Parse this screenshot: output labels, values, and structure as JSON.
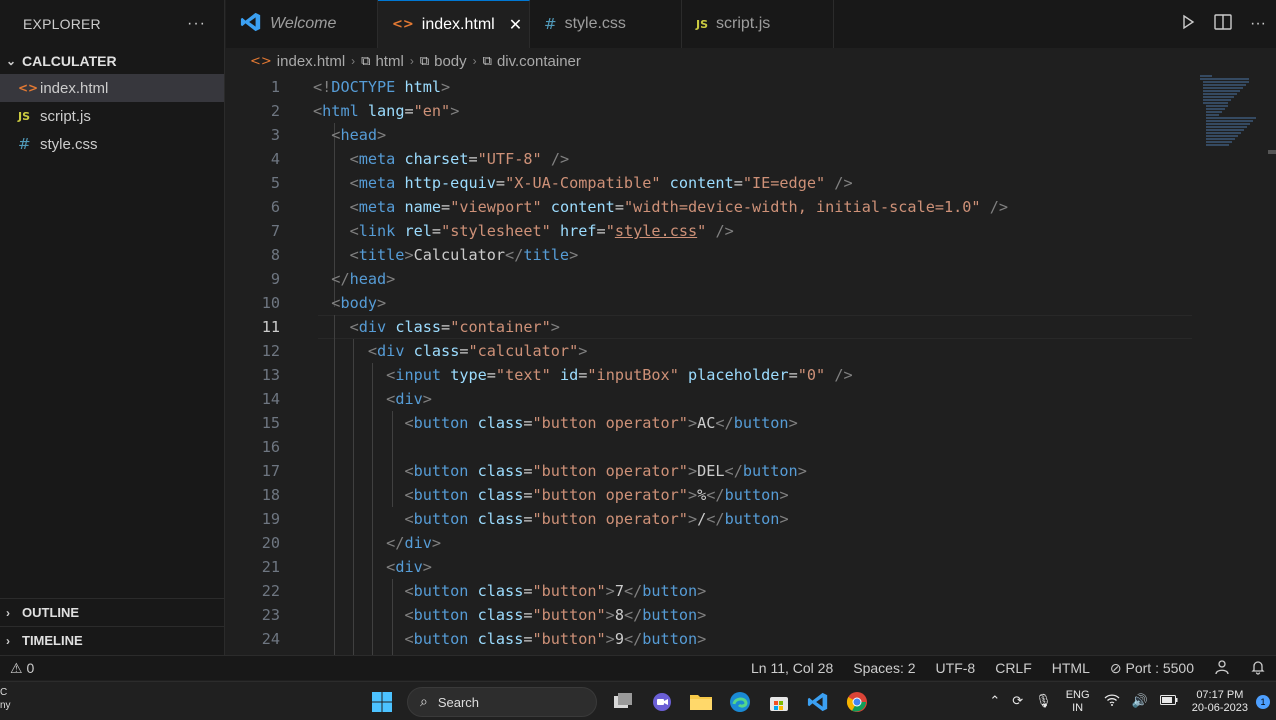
{
  "sidebar": {
    "header": "EXPLORER",
    "more": "···",
    "folder": "CALCULATER",
    "files": [
      {
        "label": "index.html",
        "icon": "html-file-icon"
      },
      {
        "label": "script.js",
        "icon": "js-file-icon"
      },
      {
        "label": "style.css",
        "icon": "css-file-icon"
      }
    ],
    "outline": "OUTLINE",
    "timeline": "TIMELINE"
  },
  "tabs": [
    {
      "label": "Welcome",
      "icon": "vscode-icon"
    },
    {
      "label": "index.html",
      "icon": "html-file-icon",
      "close": "✕"
    },
    {
      "label": "style.css",
      "icon": "css-file-icon"
    },
    {
      "label": "script.js",
      "icon": "js-file-icon"
    }
  ],
  "icons_text": {
    "html": "<>",
    "js": "JS",
    "css": "#"
  },
  "breadcrumb": [
    "index.html",
    "html",
    "body",
    "div.container"
  ],
  "line_numbers": [
    "1",
    "2",
    "3",
    "4",
    "5",
    "6",
    "7",
    "8",
    "9",
    "10",
    "11",
    "12",
    "13",
    "14",
    "15",
    "16",
    "17",
    "18",
    "19",
    "20",
    "21",
    "22",
    "23",
    "24"
  ],
  "current_line": 11,
  "code_lines": [
    [
      [
        "p",
        "<!"
      ],
      [
        "t",
        "DOCTYPE"
      ],
      [
        "x",
        " "
      ],
      [
        "a",
        "html"
      ],
      [
        "p",
        ">"
      ]
    ],
    [
      [
        "p",
        "<"
      ],
      [
        "t",
        "html"
      ],
      [
        "x",
        " "
      ],
      [
        "a",
        "lang"
      ],
      [
        "x",
        "="
      ],
      [
        "s",
        "\"en\""
      ],
      [
        "p",
        ">"
      ]
    ],
    [
      [
        "x",
        "  "
      ],
      [
        "p",
        "<"
      ],
      [
        "t",
        "head"
      ],
      [
        "p",
        ">"
      ]
    ],
    [
      [
        "x",
        "    "
      ],
      [
        "p",
        "<"
      ],
      [
        "t",
        "meta"
      ],
      [
        "x",
        " "
      ],
      [
        "a",
        "charset"
      ],
      [
        "x",
        "="
      ],
      [
        "s",
        "\"UTF-8\""
      ],
      [
        "x",
        " "
      ],
      [
        "p",
        "/>"
      ]
    ],
    [
      [
        "x",
        "    "
      ],
      [
        "p",
        "<"
      ],
      [
        "t",
        "meta"
      ],
      [
        "x",
        " "
      ],
      [
        "a",
        "http-equiv"
      ],
      [
        "x",
        "="
      ],
      [
        "s",
        "\"X-UA-Compatible\""
      ],
      [
        "x",
        " "
      ],
      [
        "a",
        "content"
      ],
      [
        "x",
        "="
      ],
      [
        "s",
        "\"IE=edge\""
      ],
      [
        "x",
        " "
      ],
      [
        "p",
        "/>"
      ]
    ],
    [
      [
        "x",
        "    "
      ],
      [
        "p",
        "<"
      ],
      [
        "t",
        "meta"
      ],
      [
        "x",
        " "
      ],
      [
        "a",
        "name"
      ],
      [
        "x",
        "="
      ],
      [
        "s",
        "\"viewport\""
      ],
      [
        "x",
        " "
      ],
      [
        "a",
        "content"
      ],
      [
        "x",
        "="
      ],
      [
        "s",
        "\"width=device-width, initial-scale=1.0\""
      ],
      [
        "x",
        " "
      ],
      [
        "p",
        "/>"
      ]
    ],
    [
      [
        "x",
        "    "
      ],
      [
        "p",
        "<"
      ],
      [
        "t",
        "link"
      ],
      [
        "x",
        " "
      ],
      [
        "a",
        "rel"
      ],
      [
        "x",
        "="
      ],
      [
        "s",
        "\"stylesheet\""
      ],
      [
        "x",
        " "
      ],
      [
        "a",
        "href"
      ],
      [
        "x",
        "="
      ],
      [
        "s",
        "\""
      ],
      [
        "su",
        "style.css"
      ],
      [
        "s",
        "\""
      ],
      [
        "x",
        " "
      ],
      [
        "p",
        "/>"
      ]
    ],
    [
      [
        "x",
        "    "
      ],
      [
        "p",
        "<"
      ],
      [
        "t",
        "title"
      ],
      [
        "p",
        ">"
      ],
      [
        "x",
        "Calculator"
      ],
      [
        "p",
        "</"
      ],
      [
        "t",
        "title"
      ],
      [
        "p",
        ">"
      ]
    ],
    [
      [
        "x",
        "  "
      ],
      [
        "p",
        "</"
      ],
      [
        "t",
        "head"
      ],
      [
        "p",
        ">"
      ]
    ],
    [
      [
        "x",
        "  "
      ],
      [
        "p",
        "<"
      ],
      [
        "t",
        "body"
      ],
      [
        "p",
        ">"
      ]
    ],
    [
      [
        "x",
        "    "
      ],
      [
        "p",
        "<"
      ],
      [
        "t",
        "div"
      ],
      [
        "x",
        " "
      ],
      [
        "a",
        "class"
      ],
      [
        "x",
        "="
      ],
      [
        "s",
        "\"container\""
      ],
      [
        "p",
        ">"
      ]
    ],
    [
      [
        "x",
        "      "
      ],
      [
        "p",
        "<"
      ],
      [
        "t",
        "div"
      ],
      [
        "x",
        " "
      ],
      [
        "a",
        "class"
      ],
      [
        "x",
        "="
      ],
      [
        "s",
        "\"calculator\""
      ],
      [
        "p",
        ">"
      ]
    ],
    [
      [
        "x",
        "        "
      ],
      [
        "p",
        "<"
      ],
      [
        "t",
        "input"
      ],
      [
        "x",
        " "
      ],
      [
        "a",
        "type"
      ],
      [
        "x",
        "="
      ],
      [
        "s",
        "\"text\""
      ],
      [
        "x",
        " "
      ],
      [
        "a",
        "id"
      ],
      [
        "x",
        "="
      ],
      [
        "s",
        "\"inputBox\""
      ],
      [
        "x",
        " "
      ],
      [
        "a",
        "placeholder"
      ],
      [
        "x",
        "="
      ],
      [
        "s",
        "\"0\""
      ],
      [
        "x",
        " "
      ],
      [
        "p",
        "/>"
      ]
    ],
    [
      [
        "x",
        "        "
      ],
      [
        "p",
        "<"
      ],
      [
        "t",
        "div"
      ],
      [
        "p",
        ">"
      ]
    ],
    [
      [
        "x",
        "          "
      ],
      [
        "p",
        "<"
      ],
      [
        "t",
        "button"
      ],
      [
        "x",
        " "
      ],
      [
        "a",
        "class"
      ],
      [
        "x",
        "="
      ],
      [
        "s",
        "\"button operator\""
      ],
      [
        "p",
        ">"
      ],
      [
        "x",
        "AC"
      ],
      [
        "p",
        "</"
      ],
      [
        "t",
        "button"
      ],
      [
        "p",
        ">"
      ]
    ],
    [],
    [
      [
        "x",
        "          "
      ],
      [
        "p",
        "<"
      ],
      [
        "t",
        "button"
      ],
      [
        "x",
        " "
      ],
      [
        "a",
        "class"
      ],
      [
        "x",
        "="
      ],
      [
        "s",
        "\"button operator\""
      ],
      [
        "p",
        ">"
      ],
      [
        "x",
        "DEL"
      ],
      [
        "p",
        "</"
      ],
      [
        "t",
        "button"
      ],
      [
        "p",
        ">"
      ]
    ],
    [
      [
        "x",
        "          "
      ],
      [
        "p",
        "<"
      ],
      [
        "t",
        "button"
      ],
      [
        "x",
        " "
      ],
      [
        "a",
        "class"
      ],
      [
        "x",
        "="
      ],
      [
        "s",
        "\"button operator\""
      ],
      [
        "p",
        ">"
      ],
      [
        "x",
        "%"
      ],
      [
        "p",
        "</"
      ],
      [
        "t",
        "button"
      ],
      [
        "p",
        ">"
      ]
    ],
    [
      [
        "x",
        "          "
      ],
      [
        "p",
        "<"
      ],
      [
        "t",
        "button"
      ],
      [
        "x",
        " "
      ],
      [
        "a",
        "class"
      ],
      [
        "x",
        "="
      ],
      [
        "s",
        "\"button operator\""
      ],
      [
        "p",
        ">"
      ],
      [
        "x",
        "/"
      ],
      [
        "p",
        "</"
      ],
      [
        "t",
        "button"
      ],
      [
        "p",
        ">"
      ]
    ],
    [
      [
        "x",
        "        "
      ],
      [
        "p",
        "</"
      ],
      [
        "t",
        "div"
      ],
      [
        "p",
        ">"
      ]
    ],
    [
      [
        "x",
        "        "
      ],
      [
        "p",
        "<"
      ],
      [
        "t",
        "div"
      ],
      [
        "p",
        ">"
      ]
    ],
    [
      [
        "x",
        "          "
      ],
      [
        "p",
        "<"
      ],
      [
        "t",
        "button"
      ],
      [
        "x",
        " "
      ],
      [
        "a",
        "class"
      ],
      [
        "x",
        "="
      ],
      [
        "s",
        "\"button\""
      ],
      [
        "p",
        ">"
      ],
      [
        "x",
        "7"
      ],
      [
        "p",
        "</"
      ],
      [
        "t",
        "button"
      ],
      [
        "p",
        ">"
      ]
    ],
    [
      [
        "x",
        "          "
      ],
      [
        "p",
        "<"
      ],
      [
        "t",
        "button"
      ],
      [
        "x",
        " "
      ],
      [
        "a",
        "class"
      ],
      [
        "x",
        "="
      ],
      [
        "s",
        "\"button\""
      ],
      [
        "p",
        ">"
      ],
      [
        "x",
        "8"
      ],
      [
        "p",
        "</"
      ],
      [
        "t",
        "button"
      ],
      [
        "p",
        ">"
      ]
    ],
    [
      [
        "x",
        "          "
      ],
      [
        "p",
        "<"
      ],
      [
        "t",
        "button"
      ],
      [
        "x",
        " "
      ],
      [
        "a",
        "class"
      ],
      [
        "x",
        "="
      ],
      [
        "s",
        "\"button\""
      ],
      [
        "p",
        ">"
      ],
      [
        "x",
        "9"
      ],
      [
        "p",
        "</"
      ],
      [
        "t",
        "button"
      ],
      [
        "p",
        ">"
      ]
    ]
  ],
  "status": {
    "left": "⚠ 0",
    "position": "Ln 11, Col 28",
    "spaces": "Spaces: 2",
    "encoding": "UTF-8",
    "eol": "CRLF",
    "language": "HTML",
    "port": "⊘ Port : 5500"
  },
  "taskbar": {
    "left_top": "C",
    "left_bottom": "ny",
    "search": "Search",
    "lang_top": "ENG",
    "lang_bottom": "IN",
    "time": "07:17 PM",
    "date": "20-06-2023",
    "notifications": "1"
  },
  "colors": {
    "accent": "#0078d4",
    "html_icon": "#e37933",
    "js_icon": "#cbcb41",
    "css_icon": "#519aba"
  }
}
